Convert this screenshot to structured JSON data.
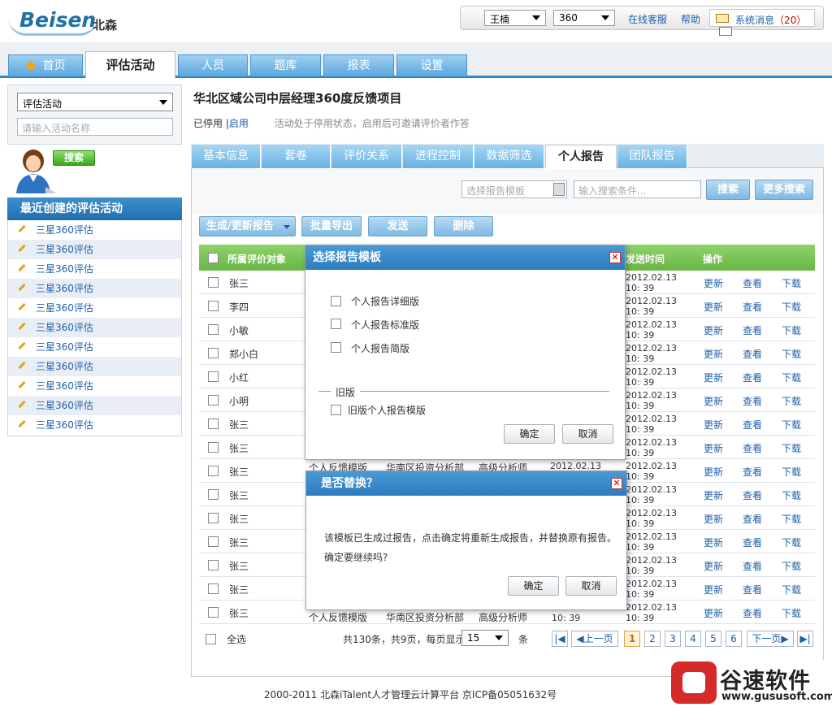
{
  "brand": {
    "name": "Beisen",
    "cn": "北森"
  },
  "topbar": {
    "user": "王楠",
    "evaluation_select": "360",
    "online_service": "在线客服",
    "help": "帮助",
    "messages_label": "系统消息",
    "messages_count": "（20）"
  },
  "nav": {
    "tabs": [
      "首页",
      "评估活动",
      "人员",
      "题库",
      "报表",
      "设置"
    ],
    "active": "评估活动"
  },
  "sidebar": {
    "select_value": "评估活动",
    "name_placeholder": "请输入活动名称",
    "search_button": "搜索",
    "recent_title": "最近创建的评估活动",
    "recent_items": [
      "三星360评估",
      "三星360评估",
      "三星360评估",
      "三星360评估",
      "三星360评估",
      "三星360评估",
      "三星360评估",
      "三星360评估",
      "三星360评估",
      "三星360评估",
      "三星360评估"
    ]
  },
  "project": {
    "title": "华北区域公司中层经理360度反馈项目",
    "status": "已停用",
    "sep": "|",
    "enable_link": "启用",
    "hint": "活动处于停用状态，启用后可邀请评价者作答"
  },
  "subtabs": {
    "items": [
      "基本信息",
      "套卷",
      "评价关系",
      "进程控制",
      "数据筛选",
      "个人报告",
      "团队报告"
    ],
    "active": "个人报告"
  },
  "filter": {
    "template_placeholder": "选择报告模板",
    "search_placeholder": "输入搜索条件...",
    "search_button": "搜索",
    "more_search_button": "更多搜索"
  },
  "actions": {
    "generate": "生成/更新报告",
    "export": "批量导出",
    "send": "发送",
    "delete": "删除"
  },
  "table": {
    "headers": {
      "subject": "所属评价对象",
      "send_time": "发送时间",
      "operation": "操作"
    },
    "row_names": [
      "张三",
      "李四",
      "小敏",
      "郑小白",
      "小红",
      "小明",
      "张三",
      "张三",
      "张三",
      "张三",
      "张三",
      "张三",
      "张三",
      "张三",
      "张三"
    ],
    "send_date": "2012.02.13",
    "send_time": "10: 39",
    "ops": {
      "update": "更新",
      "view": "查看",
      "download": "下载"
    },
    "partial_row_9": {
      "type": "个人反馈模版",
      "dept": "华南区投资分析部",
      "title": "高级分析师",
      "date": "2012.02.13"
    },
    "partial_row_15": {
      "type": "个人反馈模版",
      "dept": "华南区投资分析部",
      "title": "高级分析师"
    }
  },
  "pager": {
    "select_all": "全选",
    "summary": "共130条，共9页，每页显示",
    "page_size": "15",
    "unit": "条",
    "first": "|◀",
    "prev": "◀上一页",
    "pages": [
      "1",
      "2",
      "3",
      "4",
      "5",
      "6"
    ],
    "current": "1",
    "next": "下一页▶",
    "last": "▶|"
  },
  "dialog_template": {
    "title": "选择报告模板",
    "options": [
      "个人报告详细版",
      "个人报告标准版",
      "个人报告简版"
    ],
    "legacy_label": "旧版",
    "legacy_option": "旧版个人报告模版",
    "ok": "确定",
    "cancel": "取消"
  },
  "dialog_replace": {
    "title": "是否替换？",
    "line1": "该模板已生成过报告，点击确定将重新生成报告，并替换原有报告。",
    "line2": "确定要继续吗?",
    "ok": "确定",
    "cancel": "取消"
  },
  "footer": "2000-2011 北森iTalent人才管理云计算平台 京ICP备05051632号",
  "watermark": {
    "title": "谷速软件",
    "url": "www.gususoft.com"
  },
  "colors": {
    "accent_blue": "#2b7cc0",
    "header_green": "#6ab545",
    "link_blue": "#1f5fa8"
  }
}
